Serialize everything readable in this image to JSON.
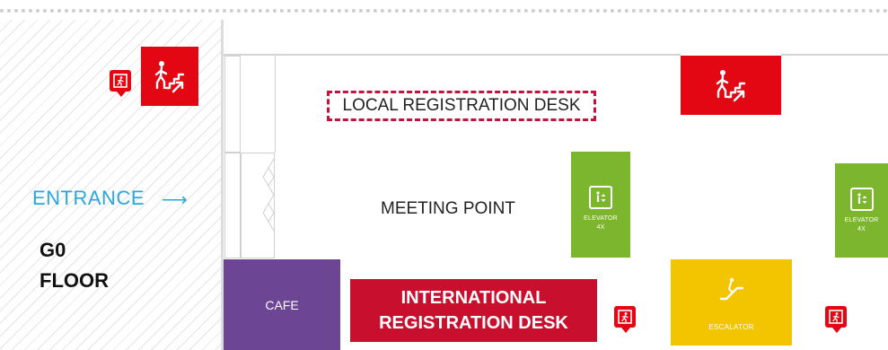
{
  "map": {
    "entrance_label": "ENTRANCE",
    "entrance_arrow": "⟶",
    "floor_line1": "G0",
    "floor_line2": "FLOOR",
    "local_desk_label": "LOCAL REGISTRATION DESK",
    "meeting_point_label": "MEETING POINT",
    "cafe_label": "CAFE",
    "intl_desk_line1": "INTERNATIONAL",
    "intl_desk_line2": "REGISTRATION DESK",
    "elevators": [
      {
        "label_line1": "ELEVATOR",
        "label_line2": "4X"
      },
      {
        "label_line1": "ELEVATOR",
        "label_line2": "4X"
      }
    ],
    "escalator_label": "ESCALATOR",
    "icons": {
      "stairs": "stairs-up-icon",
      "exit": "emergency-exit-icon",
      "elevator": "elevator-icon",
      "escalator": "escalator-icon"
    }
  },
  "colors": {
    "entrance_blue": "#2aa6de",
    "cafe_purple": "#6c4594",
    "intl_desk_red": "#c8102e",
    "stairs_red": "#e30613",
    "elevator_green": "#7cb52e",
    "escalator_yellow": "#f2c500",
    "local_desk_border": "#c0143c"
  }
}
